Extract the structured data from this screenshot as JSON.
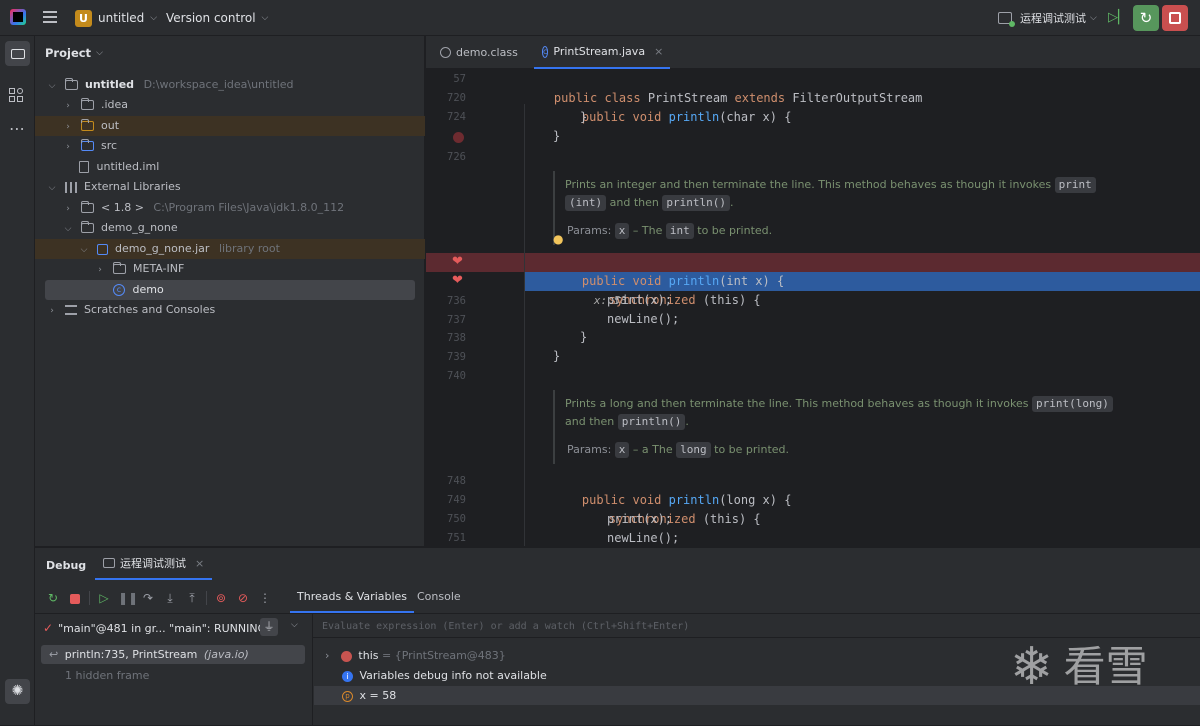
{
  "topbar": {
    "project_badge": "U",
    "project_name": "untitled",
    "vcs": "Version control",
    "run_config": "运程调试测试"
  },
  "project_panel": {
    "title": "Project",
    "tree": [
      {
        "label": "untitled",
        "hint": "D:\\workspace_idea\\untitled"
      },
      {
        "label": ".idea"
      },
      {
        "label": "out"
      },
      {
        "label": "src"
      },
      {
        "label": "untitled.iml"
      },
      {
        "label": "External Libraries"
      },
      {
        "label": "< 1.8 >",
        "hint": "C:\\Program Files\\Java\\jdk1.8.0_112"
      },
      {
        "label": "demo_g_none"
      },
      {
        "label": "demo_g_none.jar",
        "hint": "library root"
      },
      {
        "label": "META-INF"
      },
      {
        "label": "demo"
      },
      {
        "label": "Scratches and Consoles"
      }
    ]
  },
  "editor": {
    "tabs": [
      {
        "label": "demo.class"
      },
      {
        "label": "PrintStream.java"
      }
    ],
    "lines": {
      "l57": "57",
      "l720": "720",
      "l724": "724",
      "l726": "726",
      "l736": "736",
      "l737": "737",
      "l738": "738",
      "l739": "739",
      "l740": "740",
      "l748": "748",
      "l749": "749",
      "l750": "750",
      "l751": "751"
    },
    "code": {
      "c57_kw": "public class ",
      "c57_name": "PrintStream ",
      "c57_kw2": "extends ",
      "c57_rest": "FilterOutputStream",
      "c720_kw": "public void ",
      "c720_fn": "println",
      "c720_rest": "(char x) {",
      "c724": "}",
      "c726": "}",
      "c_int_kw": "public void ",
      "c_int_fn": "println",
      "c_int_rest": "(int x) {",
      "c_int_inline": "x: 58",
      "c_sync_kw": "synchronized ",
      "c_sync_rest": "(this) {",
      "c736": "print(x);",
      "c737": "newLine();",
      "c738": "}",
      "c739": "}",
      "c748_kw": "public void ",
      "c748_fn": "println",
      "c748_rest": "(long x) {",
      "c749_kw": "synchronized ",
      "c749_rest": "(this) {",
      "c750": "print(x);",
      "c751": "newLine();"
    },
    "doc1": {
      "text_a": "Prints an integer and then terminate the line. This method behaves as though it invokes",
      "chip_print": "print",
      "chip_int": "(int)",
      "text_b": "and then",
      "chip_println": "println()",
      "dot": ".",
      "params_label": "Params:",
      "param_x": "x",
      "param_text": "– The",
      "param_chip": "int",
      "param_tail": "to be printed."
    },
    "doc2": {
      "text_a": "Prints a long and then terminate the line. This method behaves as though it invokes",
      "chip_printlong": "print(long)",
      "text_b": "and then",
      "chip_println": "println()",
      "dot": ".",
      "params_label": "Params:",
      "param_x": "x",
      "param_text": "– a The",
      "param_chip": "long",
      "param_tail": "to be printed."
    }
  },
  "debug": {
    "title": "Debug",
    "session_tab": "运程调试测试",
    "subtabs": [
      "Threads & Variables",
      "Console"
    ],
    "thread": "\"main\"@481 in gr... \"main\": RUNNING",
    "frame": "println:735, PrintStream",
    "frame_pkg": "(java.io)",
    "hidden_frames": "1 hidden frame",
    "eval_placeholder": "Evaluate expression (Enter) or add a watch (Ctrl+Shift+Enter)",
    "vars": [
      {
        "name": "this",
        "value": "= {PrintStream@483}"
      },
      {
        "text": "Variables debug info not available"
      },
      {
        "name": "x",
        "value": "= 58"
      }
    ]
  },
  "watermark": {
    "text": "看雪"
  },
  "colors": {
    "accent": "#3574f0",
    "breakpoint_line": "#5c2a30",
    "exec_line": "#2d5b9e",
    "run_green": "#5fb865",
    "stop_red": "#e55b5b"
  }
}
